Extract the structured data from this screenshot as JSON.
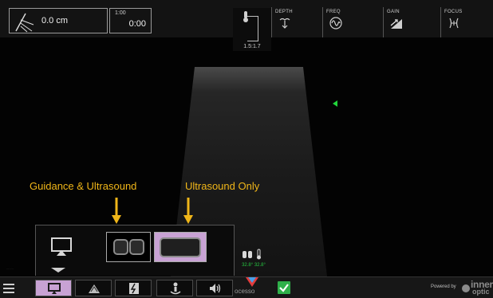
{
  "needle": {
    "distance": "0.0 cm"
  },
  "timer": {
    "top": "1:00",
    "main": "0:00"
  },
  "probe": {
    "value": "1.5:1.7"
  },
  "controls": {
    "depth_label": "DEPTH",
    "freq_label": "FREQ",
    "gain_label": "GAIN",
    "focus_label": "FOCUS"
  },
  "annotations": {
    "guidance": "Guidance & Ultrasound",
    "ultrasound_only": "Ultrasound Only"
  },
  "temperature": {
    "value": "32.8° 32.8°"
  },
  "brand": {
    "name": "ocesso"
  },
  "footer": {
    "powered_by": "Powered by",
    "logo_top": "inner",
    "logo_bottom": "optic"
  },
  "colors": {
    "accent": "#c8a2d4",
    "annotation": "#f0b619",
    "focus_marker": "#21d53a",
    "confirm": "#2fb04a"
  },
  "icons": [
    "needle-icon",
    "probe-icon",
    "depth-icon",
    "freq-icon",
    "gain-icon",
    "focus-icon",
    "display-icon",
    "menu-icon",
    "home-icon",
    "needle-guide-icon",
    "person-icon",
    "volume-icon",
    "check-icon"
  ]
}
